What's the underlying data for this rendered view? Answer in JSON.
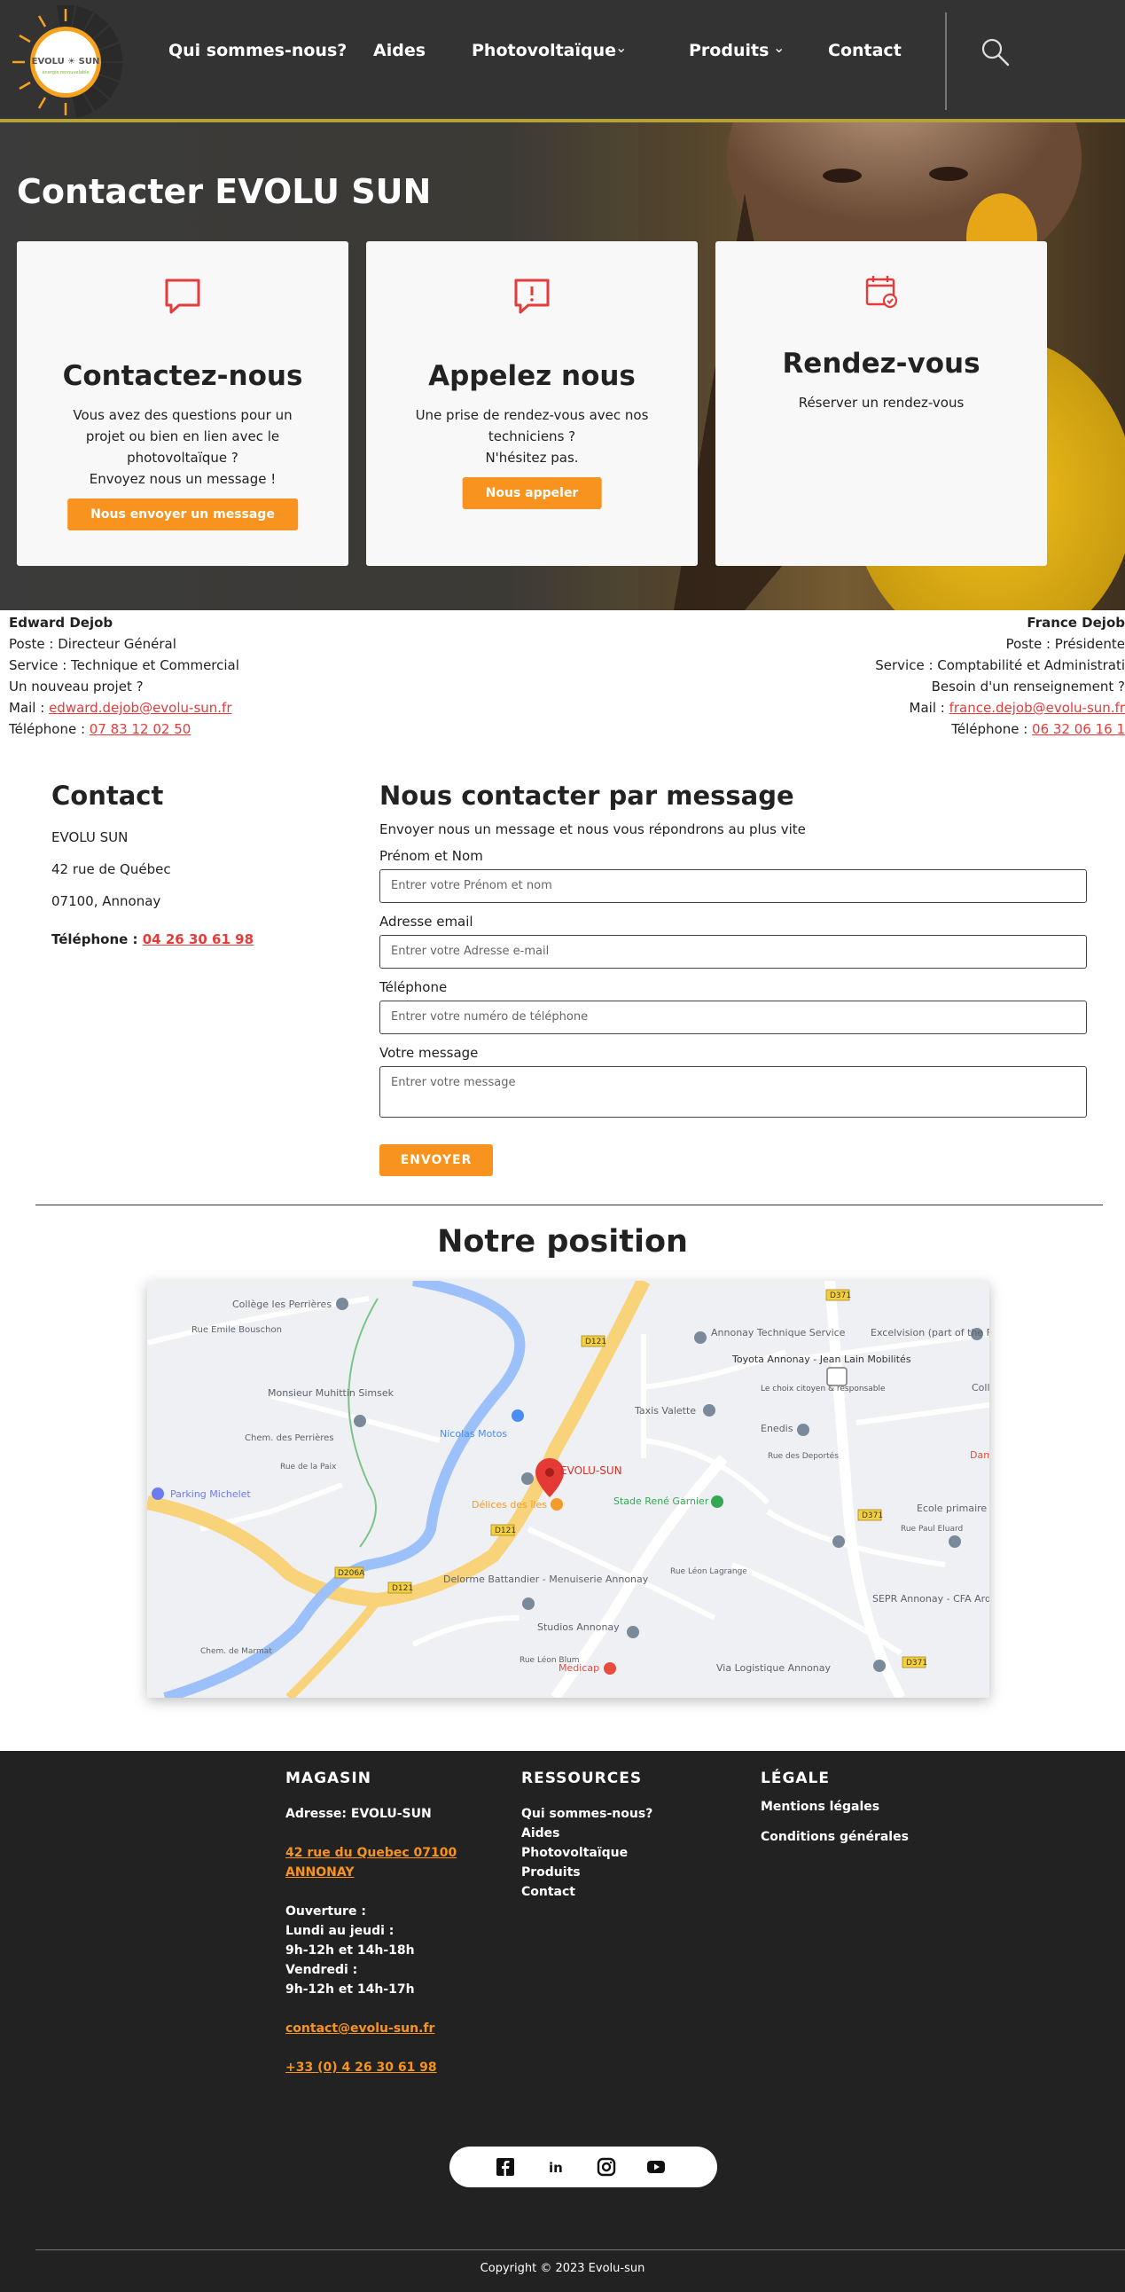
{
  "brand": {
    "logo_text": "EVOLU ☀ SUN",
    "logo_tag": "énergie renouvelable",
    "accent": "#f7931e",
    "link_red": "#e63b3b"
  },
  "nav": {
    "items": [
      {
        "label": "Qui sommes-nous?"
      },
      {
        "label": "Aides"
      },
      {
        "label": "Photovoltaïque",
        "dropdown": true
      },
      {
        "label": "Produits",
        "dropdown": true
      },
      {
        "label": "Contact"
      }
    ]
  },
  "hero": {
    "title": "Contacter EVOLU SUN",
    "cards": [
      {
        "icon": "chat-icon",
        "title": "Contactez-nous",
        "text": [
          "Vous avez des questions pour un",
          "projet ou bien en lien avec le",
          "photovoltaïque ?",
          "Envoyez nous un message !"
        ],
        "button": "Nous envoyer un message"
      },
      {
        "icon": "alert-chat-icon",
        "title": "Appelez nous",
        "text": [
          "Une prise de rendez-vous avec nos",
          "techniciens ?",
          "N'hésitez pas."
        ],
        "button": "Nous appeler"
      },
      {
        "icon": "calendar-icon",
        "title": "Rendez-vous",
        "text": [
          "Réserver un rendez-vous"
        ],
        "button": ""
      }
    ]
  },
  "people": [
    {
      "name": "Edward Dejob",
      "poste": "Poste : Directeur Général",
      "service": "Service : Technique et Commercial",
      "question": "Un nouveau projet ?",
      "mail_label": "Mail : ",
      "mail": "edward.dejob@evolu-sun.fr",
      "tel_label": "Téléphone : ",
      "tel": "07 83 12 02 50"
    },
    {
      "name": "France Dejob",
      "poste": "Poste : Présidente",
      "service": "Service : Comptabilité et Administrati",
      "question": "Besoin d'un renseignement ?",
      "mail_label": "Mail : ",
      "mail": "france.dejob@evolu-sun.fr",
      "tel_label": "Téléphone : ",
      "tel": "06 32 06 16 1"
    }
  ],
  "contact": {
    "title": "Contact",
    "company": "EVOLU SUN",
    "street": "42 rue de Québec",
    "city": "07100, Annonay",
    "tel_label": "Téléphone : ",
    "tel": "04 26 30 61 98"
  },
  "form": {
    "title": "Nous contacter par message",
    "subtitle": "Envoyer nous un message et nous vous répondrons au plus vite",
    "name_label": "Prénom et Nom",
    "name_placeholder": "Entrer votre Prénom et nom",
    "email_label": "Adresse email",
    "email_placeholder": "Entrer votre Adresse e-mail",
    "phone_label": "Téléphone",
    "phone_placeholder": "Entrer votre numéro de téléphone",
    "msg_label": "Votre message",
    "msg_placeholder": "Entrer votre message",
    "submit": "ENVOYER"
  },
  "position": {
    "title": "Notre position"
  },
  "map": {
    "marker": "EVOLU-SUN",
    "labels": [
      "Collège les Perrières",
      "Rue Emile Bouschon",
      "Annonay Technique Service",
      "Toyota Annonay - Jean Lain Mobilités",
      "Le choix citoyen & responsable",
      "Excelvision (part of the Fareva Group)",
      "Monsieur Muhittin Simsek",
      "Chem. des Perrières",
      "Taxis Valette",
      "Enedis",
      "Nicolas Motos",
      "Rue de la Paix",
      "Parking Michelet",
      "Délices des îles",
      "Stade René Garnier",
      "Ecole primaire Van Gogh - Lon",
      "Rue Paul Eluard",
      "Rue des Deportés",
      "Delorme Battandier - Menuiserie Annonay",
      "SEPR Annonay - CFA Ardèche Nord",
      "Chem. de Marmat",
      "Studios Annonay",
      "Rue Léon Lagrange",
      "Medicap",
      "Via Logistique Annonay",
      "Rue Léon Blum",
      "D121",
      "D371",
      "D206A",
      "Coll",
      "Dam"
    ]
  },
  "footer": {
    "magasin": {
      "title": "MAGASIN",
      "adresse": "Adresse: EVOLU-SUN",
      "addr1": "42 rue du Quebec 07100",
      "addr2": "ANNONAY",
      "ouverture": "Ouverture :",
      "l1": "Lundi au jeudi :",
      "l2": "9h-12h et 14h-18h",
      "l3": "Vendredi :",
      "l4": "9h-12h et 14h-17h",
      "email": "contact@evolu-sun.fr",
      "phone": "+33 (0) 4 26 30 61 98"
    },
    "ressources": {
      "title": "RESSOURCES",
      "links": [
        "Qui sommes-nous?",
        "Aides",
        "Photovoltaïque",
        "Produits",
        "Contact"
      ]
    },
    "legale": {
      "title": "LÉGALE",
      "links": [
        "Mentions légales",
        "Conditions générales"
      ]
    },
    "social": [
      "facebook-icon",
      "linkedin-icon",
      "instagram-icon",
      "youtube-icon"
    ],
    "copyright": "Copyright © 2023 Evolu-sun"
  }
}
